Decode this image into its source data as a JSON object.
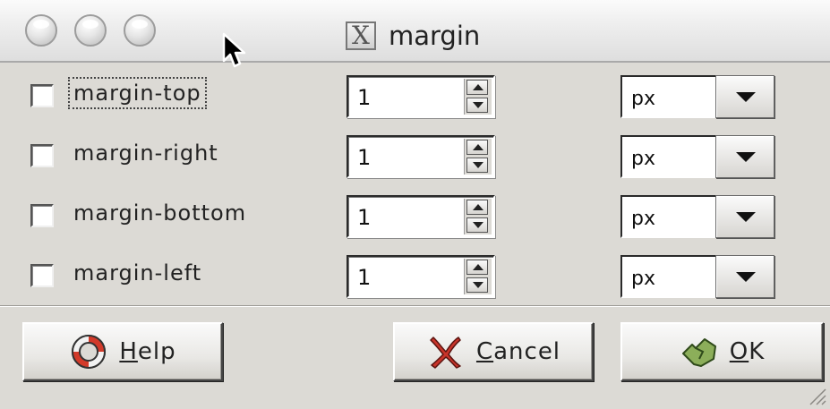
{
  "window": {
    "title": "margin"
  },
  "rows": [
    {
      "label": "margin-top",
      "value": "1",
      "unit": "px",
      "checked": false,
      "focused": true
    },
    {
      "label": "margin-right",
      "value": "1",
      "unit": "px",
      "checked": false,
      "focused": false
    },
    {
      "label": "margin-bottom",
      "value": "1",
      "unit": "px",
      "checked": false,
      "focused": false
    },
    {
      "label": "margin-left",
      "value": "1",
      "unit": "px",
      "checked": false,
      "focused": false
    }
  ],
  "buttons": {
    "help": {
      "mnemonic": "H",
      "rest": "elp",
      "icon": "lifebuoy-icon"
    },
    "cancel": {
      "mnemonic": "C",
      "rest": "ancel",
      "icon": "red-x-icon"
    },
    "ok": {
      "mnemonic": "O",
      "rest": "K",
      "icon": "ok-hand-icon"
    }
  },
  "colors": {
    "window_bg": "#dcdad5",
    "cancel_icon": "#c8342a",
    "ok_icon": "#6b8f3f",
    "help_icon": "#d23a2a"
  }
}
